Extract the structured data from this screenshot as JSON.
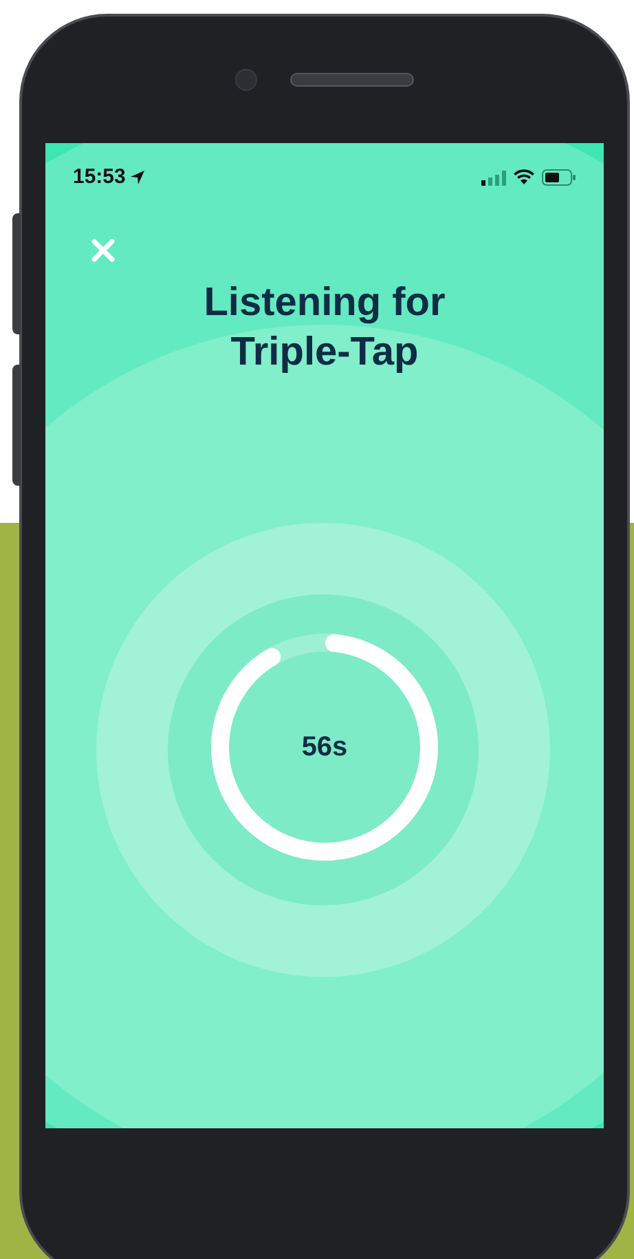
{
  "status_bar": {
    "time": "15:53"
  },
  "title": "Listening for Triple-Tap",
  "timer": {
    "remaining": "56s",
    "level": 0.93
  }
}
